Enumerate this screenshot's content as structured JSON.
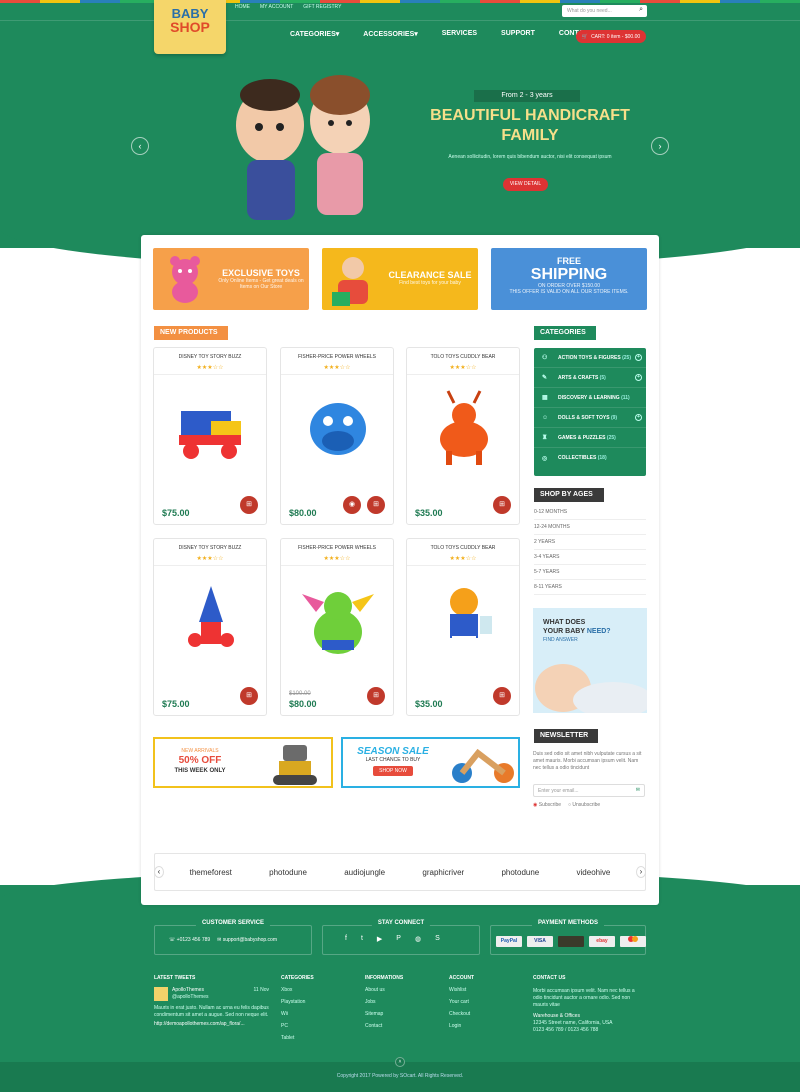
{
  "header": {
    "top_links": [
      "HOME",
      "MY ACCOUNT",
      "GIFT REGISTRY"
    ],
    "search_placeholder": "What do you need...",
    "logo": [
      "BABY",
      "SHOP"
    ],
    "nav": [
      "CATEGORIES",
      "ACCESSORIES",
      "SERVICES",
      "SUPPORT",
      "CONTACT"
    ],
    "cart": "CART: 0 item - $00.00"
  },
  "slider": {
    "subtitle": "From 2 - 3 years",
    "title": "BEAUTIFUL HANDICRAFT FAMILY",
    "desc": "Aenean sollicitudin, lorem quis bibendum auctor, nisi elit consequat ipsum",
    "button": "VIEW DETAIL"
  },
  "banners": [
    {
      "title": "EXCLUSIVE TOYS",
      "sub": "Only Online Items - Get great deals on Items on Our Store",
      "color": "#f6a04a"
    },
    {
      "title": "CLEARANCE SALE",
      "sub": "Find best toys for your baby",
      "color": "#f5b81c"
    },
    {
      "title": "FREE",
      "title2": "SHIPPING",
      "sub": "ON ORDER OVER $150.00",
      "sub2": "THIS OFFER IS VALID ON ALL OUR STORE ITEMS.",
      "color": "#4a90d8"
    }
  ],
  "new_products": {
    "title": "NEW PRODUCTS",
    "items": [
      {
        "name": "DISNEY TOY STORY BUZZ",
        "price": "$75.00"
      },
      {
        "name": "FISHER-PRICE POWER WHEELS",
        "price": "$80.00"
      },
      {
        "name": "TOLO TOYS CUDDLY BEAR",
        "price": "$35.00"
      },
      {
        "name": "DISNEY TOY STORY BUZZ",
        "price": "$75.00"
      },
      {
        "name": "FISHER-PRICE POWER WHEELS",
        "price": "$80.00",
        "old": "$100.00"
      },
      {
        "name": "TOLO TOYS CUDDLY BEAR",
        "price": "$35.00"
      }
    ]
  },
  "categories": {
    "title": "CATEGORIES",
    "items": [
      {
        "name": "ACTION TOYS & FIGURES",
        "count": "(25)"
      },
      {
        "name": "ARTS & CRAFTS",
        "count": "(5)"
      },
      {
        "name": "DISCOVERY & LEARNING",
        "count": "(11)"
      },
      {
        "name": "DOLLS & SOFT TOYS",
        "count": "(9)"
      },
      {
        "name": "GAMES & PUZZLES",
        "count": "(25)"
      },
      {
        "name": "COLLECTIBLES",
        "count": "(18)"
      }
    ]
  },
  "ages": {
    "title": "SHOP BY AGES",
    "items": [
      "0-12 MONTHS",
      "12-24 MONTHS",
      "2 YEARS",
      "3-4 YEARS",
      "5-7 YEARS",
      "8-11 YEARS"
    ]
  },
  "promo": {
    "line1": "WHAT DOES",
    "line2": "YOUR BABY",
    "line3": "NEED?",
    "link": "FIND ANSWER"
  },
  "newsletter": {
    "title": "NEWSLETTER",
    "text": "Duis sed odio sit amet nibh vulputate cursus a sit amet mauris. Morbi accumsan ipsum velit. Nam nec tellus a odio tincidunt",
    "placeholder": "Enter your email...",
    "subscribe": "Subscribe",
    "unsubscribe": "Unsubscribe"
  },
  "wide_banners": {
    "left": {
      "l1": "NEW ARRIVALS",
      "l2": "50% OFF",
      "l3": "THIS WEEK ONLY"
    },
    "right": {
      "l1": "SEASON SALE",
      "l2": "LAST CHANCE TO BUY",
      "btn": "SHOP NOW"
    }
  },
  "brands": [
    "themeforest",
    "photodune",
    "audiojungle",
    "graphicriver",
    "photodune",
    "videohive"
  ],
  "footer": {
    "customer_service": {
      "title": "CUSTOMER SERVICE",
      "phone": "+0123 456 789",
      "email": "support@babyshop.com"
    },
    "stay_connect": "STAY CONNECT",
    "payment": {
      "title": "PAYMENT METHODS",
      "items": [
        "PayPal",
        "VISA",
        "",
        "ebay",
        ""
      ]
    },
    "tweets": {
      "title": "LATEST TWEETS",
      "user": "ApolloThemes",
      "handle": "@apolloThemes",
      "date": "11 Nov",
      "text": "Mauris in erat justo. Nullam ac urna eu felis dapibus condimentum sit amet a augue. Sed non neque elit.",
      "link": "http://demoapollothemes.com/ap_flora/..."
    },
    "categories": {
      "title": "CATEGORIES",
      "items": [
        "Xbox",
        "Playstation",
        "Wii",
        "PC",
        "Tablet"
      ]
    },
    "informations": {
      "title": "INFORMATIONS",
      "items": [
        "About us",
        "Jobs",
        "Sitemap",
        "Contact"
      ]
    },
    "account": {
      "title": "ACCOUNT",
      "items": [
        "Wishlist",
        "Your cart",
        "Checkout",
        "Login"
      ]
    },
    "contact": {
      "title": "CONTACT US",
      "text": "Morbi accumsan ipsum velit. Nam nec tellus a odio tincidunt auctor a ornare odio. Sed non mauris vitae",
      "wh": "Warehouse & Offices",
      "addr": "12345 Street name, California, USA",
      "phone": "0123 456 789 / 0123 456 788"
    },
    "copyright": "Copyright 2017 Powered by SOcart. All Rights Reserved."
  }
}
